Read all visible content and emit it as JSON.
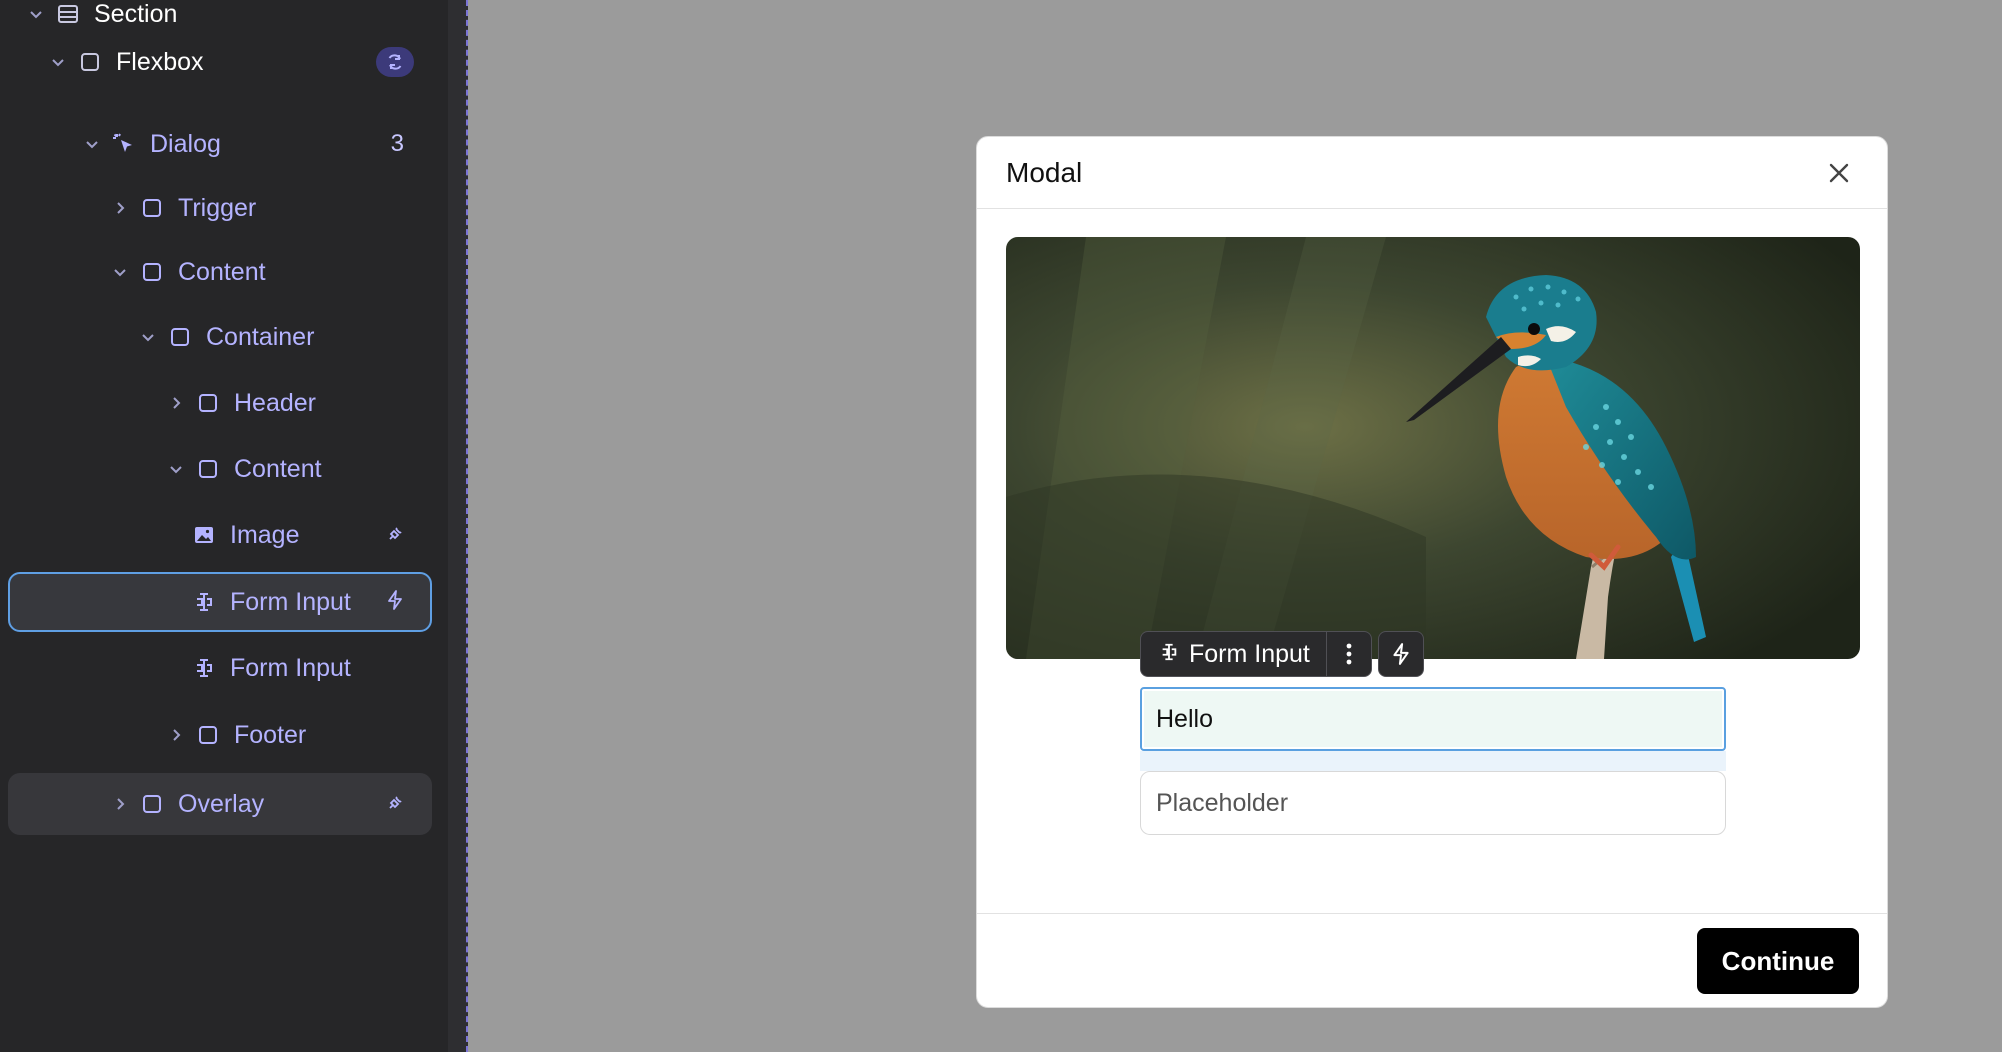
{
  "sidebar": {
    "rows": [
      {
        "label": "Section",
        "icon": "section-icon",
        "chevron": "down"
      },
      {
        "label": "Flexbox",
        "icon": "box-icon",
        "chevron": "down",
        "badge": "sync-icon"
      },
      {
        "label": "Dialog",
        "icon": "cursor-click-icon",
        "chevron": "down",
        "count": "3"
      },
      {
        "label": "Trigger",
        "icon": "box-icon",
        "chevron": "right"
      },
      {
        "label": "Content",
        "icon": "box-icon",
        "chevron": "down"
      },
      {
        "label": "Container",
        "icon": "box-icon",
        "chevron": "down"
      },
      {
        "label": "Header",
        "icon": "box-icon",
        "chevron": "right"
      },
      {
        "label": "Content",
        "icon": "box-icon",
        "chevron": "down"
      },
      {
        "label": "Image",
        "icon": "image-icon",
        "badge": "plug-icon"
      },
      {
        "label": "Form Input",
        "icon": "form-input-icon",
        "badge": "bolt-icon",
        "selected": true
      },
      {
        "label": "Form Input",
        "icon": "form-input-icon"
      },
      {
        "label": "Footer",
        "icon": "box-icon",
        "chevron": "right"
      },
      {
        "label": "Overlay",
        "icon": "box-icon",
        "chevron": "right",
        "badge": "plug-icon",
        "hovered": true
      }
    ]
  },
  "modal": {
    "title": "Modal",
    "image_alt": "Kingfisher perched on a branch",
    "toolbar": {
      "element_name": "Form Input"
    },
    "input_value": "Hello",
    "input2_placeholder": "Placeholder",
    "continue_label": "Continue"
  },
  "colors": {
    "canvas_bg": "#9b9b9b",
    "sidebar_bg": "#262628",
    "tree_text": "#b4b3ff",
    "selection_border": "#5f9fe4",
    "button_bg": "#000000"
  }
}
